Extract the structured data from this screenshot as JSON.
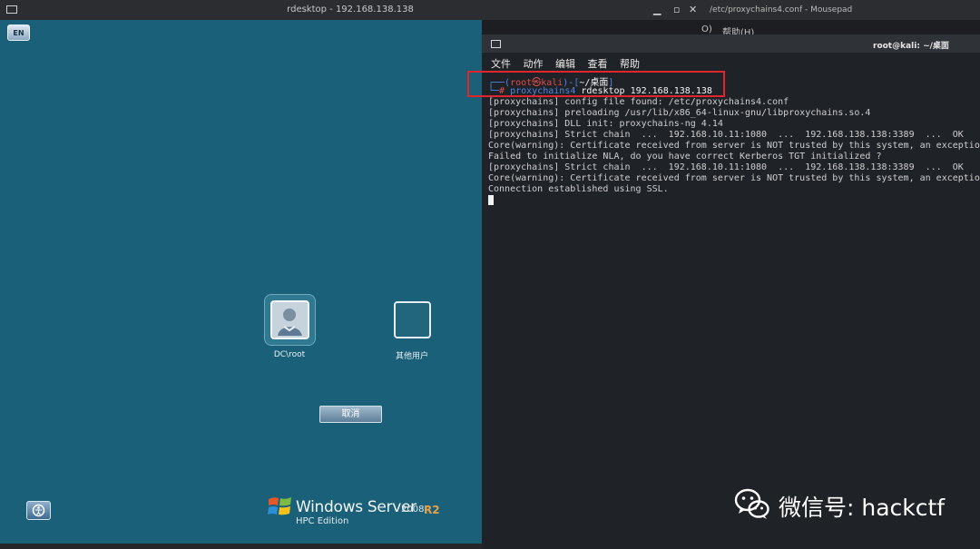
{
  "rdesktop": {
    "window_title": "rdesktop - 192.168.138.138",
    "ime_indicator": "EN",
    "user_root_label": "DC\\root",
    "user_other_label": "其他用户",
    "cancel_label": "取消",
    "branding": {
      "product": "Windows Server",
      "version": "2008",
      "release": "R2",
      "edition": "HPC Edition"
    }
  },
  "mousepad": {
    "window_title": "/etc/proxychains4.conf - Mousepad",
    "menu_fragment": "O)",
    "menu_help": "帮助(H)"
  },
  "terminal": {
    "window_title": "root@kali: ~/桌面",
    "menu": [
      "文件",
      "动作",
      "编辑",
      "查看",
      "帮助"
    ],
    "prompt": {
      "user": "root",
      "host": "kali",
      "dir": "~/桌面",
      "command_bin": "proxychains4",
      "command_args": "rdesktop 192.168.138.138"
    },
    "output": [
      "[proxychains] config file found: /etc/proxychains4.conf",
      "[proxychains] preloading /usr/lib/x86_64-linux-gnu/libproxychains.so.4",
      "[proxychains] DLL init: proxychains-ng 4.14",
      "[proxychains] Strict chain  ...  192.168.10.11:1080  ...  192.168.138.138:3389  ...  OK",
      "Core(warning): Certificate received from server is NOT trusted by this system, an exceptio",
      "Failed to initialize NLA, do you have correct Kerberos TGT initialized ?",
      "[proxychains] Strict chain  ...  192.168.10.11:1080  ...  192.168.138.138:3389  ...  OK",
      "Core(warning): Certificate received from server is NOT trusted by this system, an exceptio",
      "Connection established using SSL."
    ]
  },
  "watermark": {
    "text": "微信号: hackctf"
  },
  "colors": {
    "rdesktop_bg": "#1a6078",
    "terminal_bg": "#1f2226",
    "highlight_box": "#e0262d",
    "prompt_red": "#e34b4b",
    "prompt_blue": "#4f86e8"
  }
}
